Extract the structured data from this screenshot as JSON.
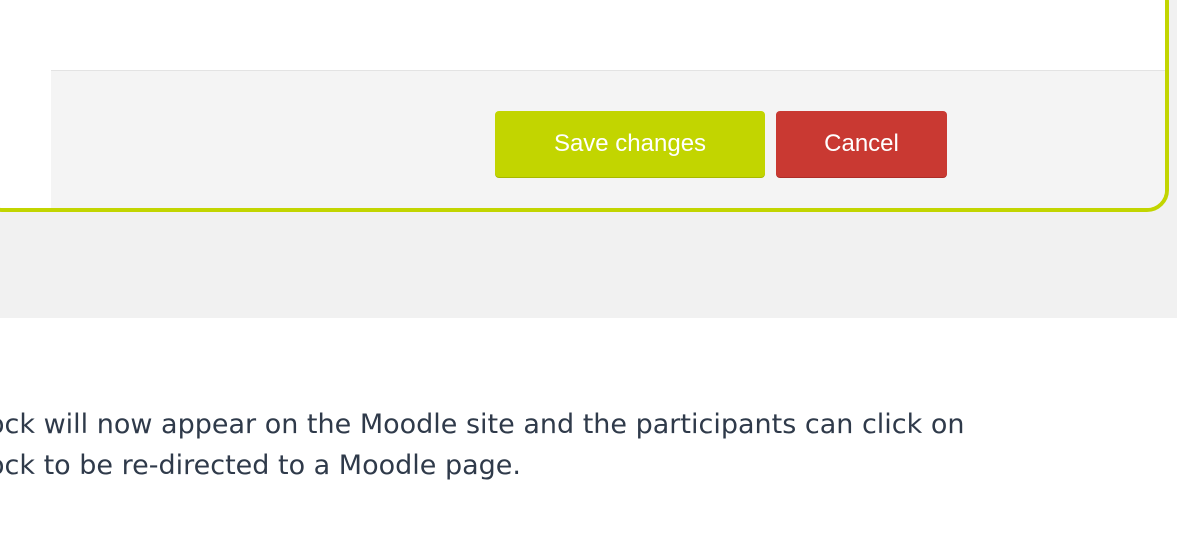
{
  "modal": {
    "footer": {
      "save_label": "Save changes",
      "cancel_label": "Cancel"
    }
  },
  "colors": {
    "accent": "#c2d500",
    "danger": "#c93932",
    "footer_bg": "#f4f4f4",
    "band_bg": "#f1f1f1",
    "text": "#2f3a4a"
  },
  "caption": {
    "line1": "ock will now appear on the Moodle site and the participants can click on",
    "line2": "ock to be re-directed to a Moodle page."
  }
}
